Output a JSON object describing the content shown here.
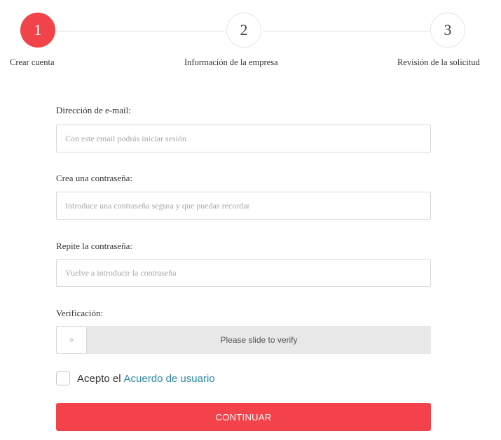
{
  "stepper": {
    "steps": [
      {
        "number": "1",
        "label": "Crear cuenta",
        "state": "active"
      },
      {
        "number": "2",
        "label": "Información de la empresa",
        "state": "pending"
      },
      {
        "number": "3",
        "label": "Revisión de la solicitud",
        "state": "pending"
      }
    ]
  },
  "form": {
    "email": {
      "label": "Dirección de e-mail:",
      "value": "",
      "placeholder": "Con este email podrás iniciar sesión"
    },
    "password": {
      "label": "Crea una contraseña:",
      "value": "",
      "placeholder": "Introduce una contraseña segura y que puedas recordar"
    },
    "repeat_password": {
      "label": "Repite la contraseña:",
      "value": "",
      "placeholder": "Vuelve a introducir la contraseña"
    },
    "verification": {
      "label": "Verificación:",
      "handle_glyph": "»",
      "slider_text": "Please slide to verify"
    },
    "terms": {
      "text": "Acepto el",
      "link_text": "Acuerdo de usuario",
      "checked": false
    },
    "continue_label": "CONTINUAR"
  },
  "colors": {
    "accent": "#f4424a",
    "link": "#2a8aa8",
    "slider_bg": "#e8e8e8",
    "border": "#d9d9d9"
  },
  "icons": {
    "slider_handle": "double-chevron-right-icon"
  }
}
